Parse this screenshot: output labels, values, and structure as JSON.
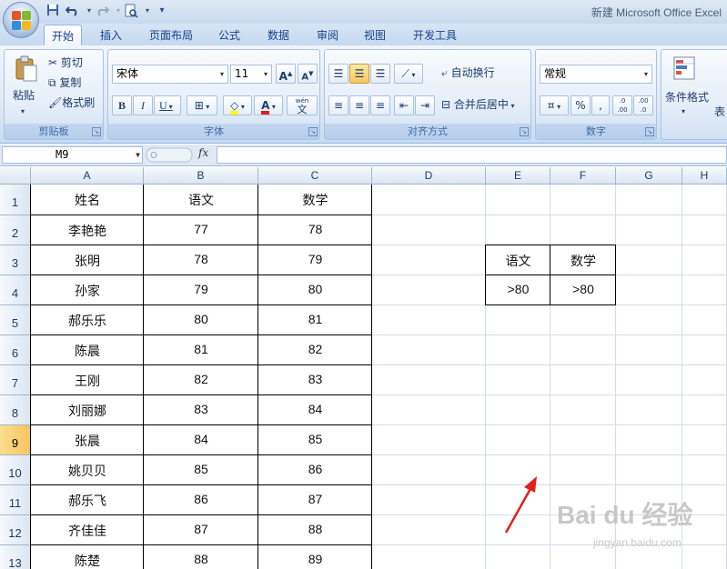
{
  "window": {
    "title": "新建 Microsoft Office Excel"
  },
  "quick_access": {
    "save": "save-icon",
    "undo": "undo-icon",
    "redo": "redo-icon",
    "preview": "print-preview-icon",
    "customize": "▾"
  },
  "tabs": [
    "开始",
    "插入",
    "页面布局",
    "公式",
    "数据",
    "审阅",
    "视图",
    "开发工具"
  ],
  "active_tab": "开始",
  "ribbon": {
    "clipboard": {
      "label": "剪贴板",
      "paste": "粘贴",
      "cut": "剪切",
      "copy": "复制",
      "format_painter": "格式刷"
    },
    "font": {
      "label": "字体",
      "font_name": "宋体",
      "font_size": "11",
      "grow": "A",
      "shrink": "A",
      "bold": "B",
      "italic": "I",
      "underline": "U",
      "wen": "wén",
      "wen_char": "文"
    },
    "alignment": {
      "label": "对齐方式",
      "wrap_text": "自动换行",
      "merge_center": "合并后居中"
    },
    "number": {
      "label": "数字",
      "format": "常规",
      "percent": "%",
      "comma": ",",
      "inc_dec": ".0 .00",
      "dec_dec": ".00 .0"
    },
    "styles": {
      "conditional_format": "条件格式",
      "table_format_partial": "表"
    }
  },
  "formula_bar": {
    "name_box": "M9",
    "fx": "fx",
    "formula": ""
  },
  "columns": [
    "A",
    "B",
    "C",
    "D",
    "E",
    "F",
    "G",
    "H"
  ],
  "rows": [
    "1",
    "2",
    "3",
    "4",
    "5",
    "6",
    "7",
    "8",
    "9",
    "10",
    "11",
    "12",
    "13"
  ],
  "selected_row": "9",
  "table": {
    "headers": [
      "姓名",
      "语文",
      "数学"
    ],
    "rows": [
      [
        "李艳艳",
        "77",
        "78"
      ],
      [
        "张明",
        "78",
        "79"
      ],
      [
        "孙家",
        "79",
        "80"
      ],
      [
        "郝乐乐",
        "80",
        "81"
      ],
      [
        "陈晨",
        "81",
        "82"
      ],
      [
        "王刚",
        "82",
        "83"
      ],
      [
        "刘丽娜",
        "83",
        "84"
      ],
      [
        "张晨",
        "84",
        "85"
      ],
      [
        "姚贝贝",
        "85",
        "86"
      ],
      [
        "郝乐飞",
        "86",
        "87"
      ],
      [
        "齐佳佳",
        "87",
        "88"
      ],
      [
        "陈楚",
        "88",
        "89"
      ]
    ]
  },
  "criteria": {
    "headers": [
      "语文",
      "数学"
    ],
    "values": [
      ">80",
      ">80"
    ]
  },
  "annotation_color": "#e0201c",
  "watermark": {
    "main": "Bai du 经验",
    "sub": "jingyan.baidu.com"
  }
}
